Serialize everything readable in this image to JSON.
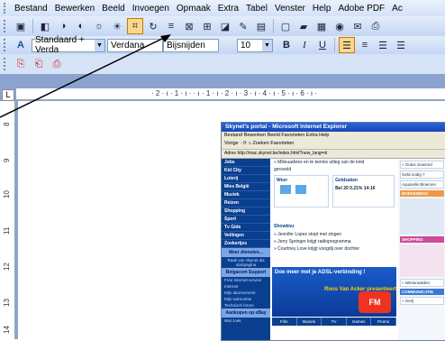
{
  "menu": [
    "Bestand",
    "Bewerken",
    "Beeld",
    "Invoegen",
    "Opmaak",
    "Extra",
    "Tabel",
    "Venster",
    "Help",
    "Adobe PDF",
    "Ac"
  ],
  "toolbar2": {
    "style_value": "Standaard + Verda",
    "font_value": "Verdana",
    "position_value": "Bijsnijden",
    "size_value": "10",
    "bold_label": "B",
    "italic_label": "I",
    "underline_label": "U"
  },
  "ruler": {
    "corner_symbol": "L",
    "hticks": "· 2 · ı · 1 · ı ·   · ı · 1 · ı · 2 · ı · 3 · ı · 4 · ı · 5 · ı · 6 · ı ·",
    "vticks": [
      "8",
      "9",
      "10",
      "11",
      "12",
      "13",
      "14"
    ]
  },
  "screenshot": {
    "window_title": "Skynet's portal - Microsoft Internet Explorer",
    "ie_menu": "Bestand  Bewerken  Beeld  Favorieten  Extra  Help",
    "ie_tools": "Vorige ·  ⟳  ⌂   Zoeken   Favorieten",
    "address": "Adres  http://mac.skynet.be/index.html?new_lang=nl",
    "sidebar": [
      "Jobs",
      "Kid City",
      "Loterij",
      "Mies België",
      "Muziek",
      "Reizen",
      "Shopping",
      "Sport",
      "Tv Gids",
      "Veilingen",
      "Zoekertjes"
    ],
    "sidebar_more": "Meer diensten...",
    "sidebar_help": "Raak van Skynet als startpagina",
    "support_title": "Belgacom Support",
    "support_items": [
      "Free Internet service",
      "Internet",
      "Mijn abonnement",
      "Mijn webruimte",
      "Technisch forum"
    ],
    "shopping_title": "Aankopen op eBay",
    "shopping_sub": "Wat zoek",
    "main_lines": [
      "» Milieuadvies en te kennis uitleg van de kind",
      "gerosold"
    ],
    "weer_label": "Weer",
    "geld_label": "Geldzaken",
    "bel_label": "Bel 20 0.21% 14:16",
    "news_title": "Showbizz",
    "news_items": [
      "» Jennifer Lopez stopt met zingen",
      "» Jerry Springer krijgt radioprogramma",
      "» Courtney Love krijgt voogdij over dochter"
    ],
    "promo_title": "Doe meer met je ADSL-verbinding !",
    "promo_name": "Roos Van Acker presenteert",
    "promo_logo": "FM",
    "tabs": [
      "Film",
      "Muziek",
      "TV",
      "Games",
      "Promo"
    ],
    "right_items": [
      "» Gratis vloeiend",
      "Geld nodig ?",
      "Aquarelle Bloemen"
    ],
    "right_labels": [
      "BOEKENBOX",
      "SHOPPING",
      "COMMUNICATIE"
    ],
    "right_tags": [
      "» Winterwalden",
      "» Gerij"
    ]
  }
}
